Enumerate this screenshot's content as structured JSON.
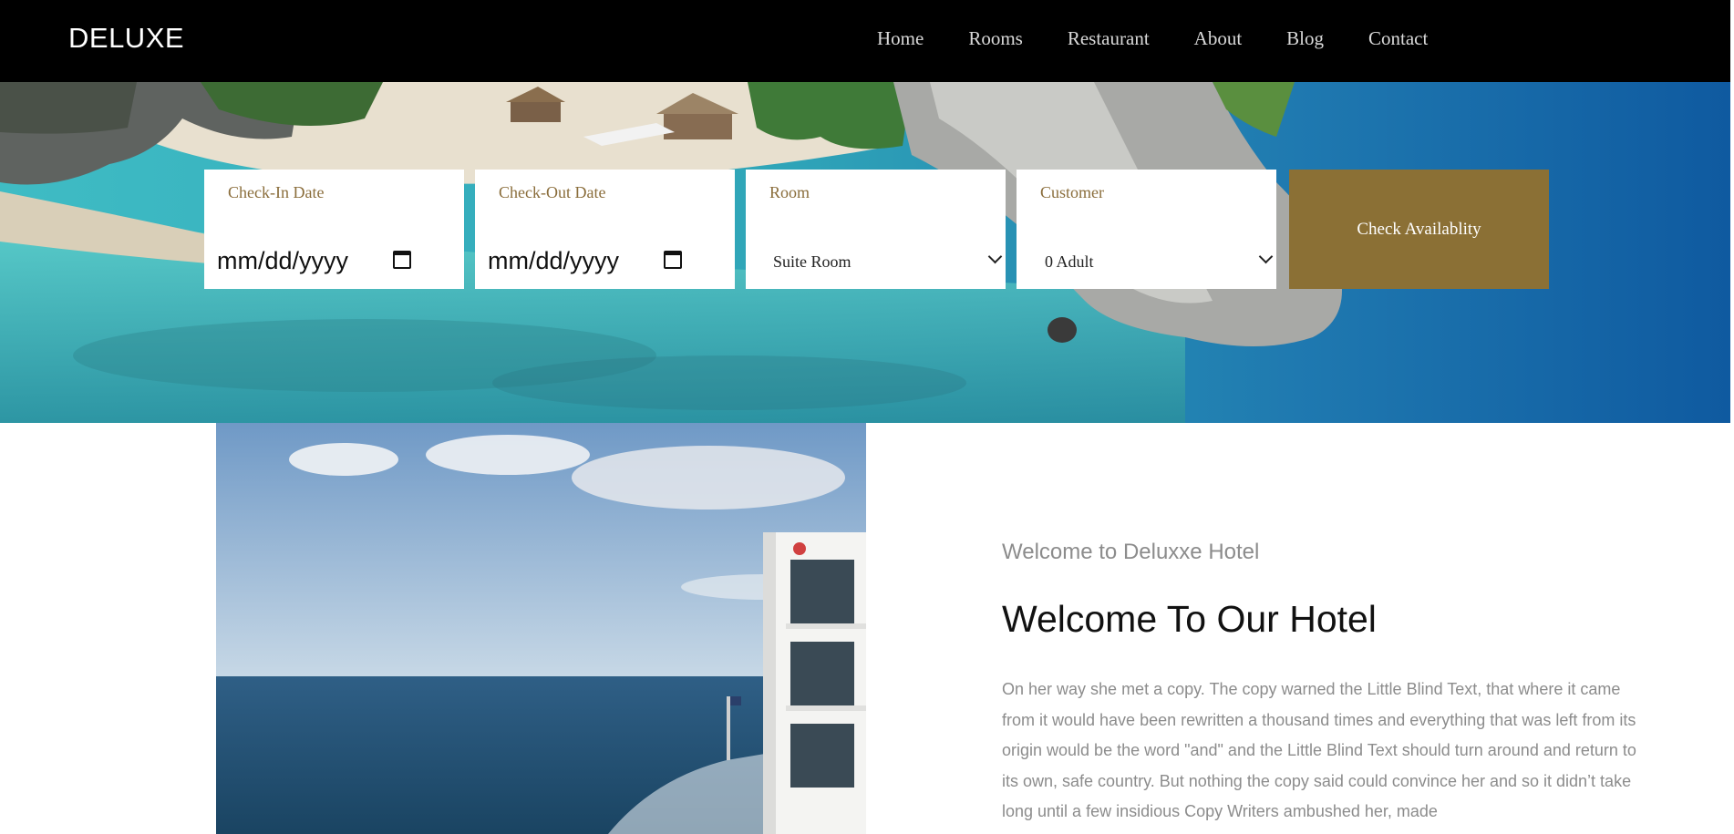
{
  "brand": "DELUXE",
  "nav": [
    "Home",
    "Rooms",
    "Restaurant",
    "About",
    "Blog",
    "Contact"
  ],
  "booking": {
    "checkin_label": "Check-In Date",
    "checkin_value": "mm/dd/yyyy",
    "checkout_label": "Check-Out Date",
    "checkout_value": "mm/dd/yyyy",
    "room_label": "Room",
    "room_value": "Suite Room",
    "customer_label": "Customer",
    "customer_value": "0 Adult",
    "button": "Check Availablity"
  },
  "about": {
    "subtitle": "Welcome to Deluxxe Hotel",
    "title": "Welcome To Our Hotel",
    "text": "On her way she met a copy. The copy warned the Little Blind Text, that where it came from it would have been rewritten a thousand times and everything that was left from its origin would be the word \"and\" and the Little Blind Text should turn around and return to its own, safe country. But nothing the copy said could convince her and so it didn’t take long until a few insidious Copy Writers ambushed her, made"
  },
  "colors": {
    "nav_bg": "#000000",
    "accent": "#8b7035",
    "label": "#8a6d3b",
    "muted_text": "#8c8c8c"
  }
}
